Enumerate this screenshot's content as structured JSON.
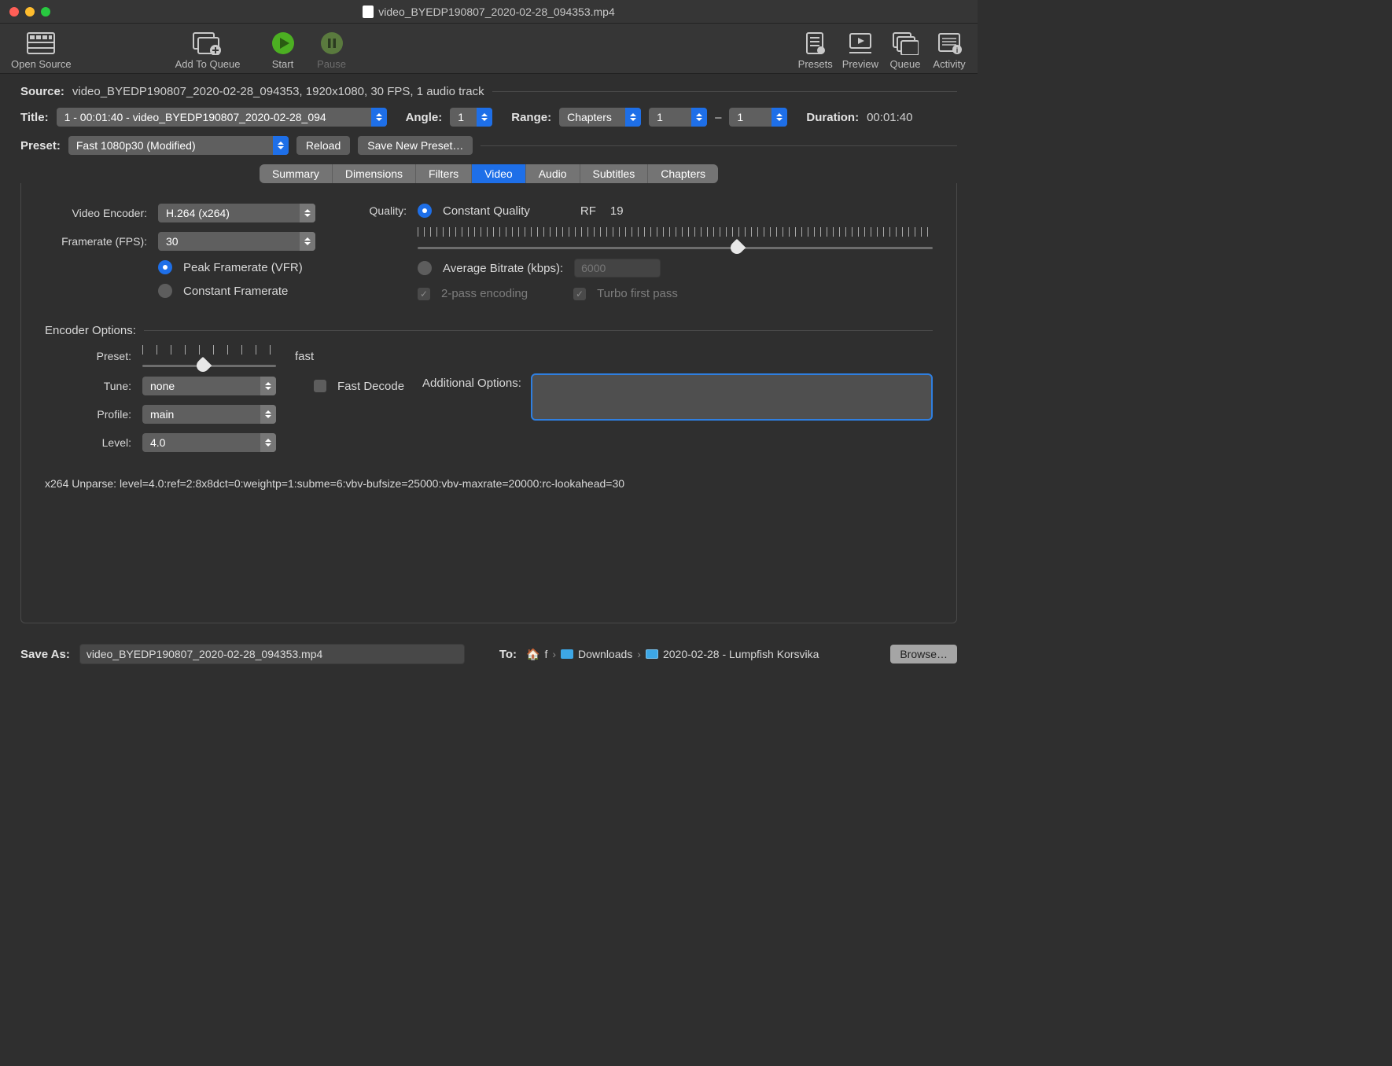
{
  "window": {
    "title": "video_BYEDP190807_2020-02-28_094353.mp4"
  },
  "toolbar": {
    "open_source": "Open Source",
    "add_to_queue": "Add To Queue",
    "start": "Start",
    "pause": "Pause",
    "presets": "Presets",
    "preview": "Preview",
    "queue": "Queue",
    "activity": "Activity"
  },
  "source": {
    "label": "Source:",
    "value": "video_BYEDP190807_2020-02-28_094353, 1920x1080, 30 FPS, 1 audio track"
  },
  "title_row": {
    "label": "Title:",
    "value": "1 - 00:01:40 - video_BYEDP190807_2020-02-28_094",
    "angle_label": "Angle:",
    "angle_value": "1",
    "range_label": "Range:",
    "range_type": "Chapters",
    "range_from": "1",
    "range_sep": "–",
    "range_to": "1",
    "duration_label": "Duration:",
    "duration_value": "00:01:40"
  },
  "preset_row": {
    "label": "Preset:",
    "value": "Fast 1080p30 (Modified)",
    "reload": "Reload",
    "save_new": "Save New Preset…"
  },
  "tabs": [
    "Summary",
    "Dimensions",
    "Filters",
    "Video",
    "Audio",
    "Subtitles",
    "Chapters"
  ],
  "active_tab": "Video",
  "video": {
    "encoder_label": "Video Encoder:",
    "encoder_value": "H.264 (x264)",
    "fps_label": "Framerate (FPS):",
    "fps_value": "30",
    "peak_label": "Peak Framerate (VFR)",
    "constant_label": "Constant Framerate",
    "quality_label": "Quality:",
    "cq_label": "Constant Quality",
    "rf_label": "RF",
    "rf_value": "19",
    "abr_label": "Average Bitrate (kbps):",
    "abr_value": "6000",
    "two_pass": "2-pass encoding",
    "turbo": "Turbo first pass",
    "enc_opts_label": "Encoder Options:",
    "preset_label": "Preset:",
    "preset_value": "fast",
    "tune_label": "Tune:",
    "tune_value": "none",
    "fast_decode": "Fast Decode",
    "profile_label": "Profile:",
    "profile_value": "main",
    "addl_label": "Additional Options:",
    "addl_value": "",
    "level_label": "Level:",
    "level_value": "4.0",
    "unparse": "x264 Unparse: level=4.0:ref=2:8x8dct=0:weightp=1:subme=6:vbv-bufsize=25000:vbv-maxrate=20000:rc-lookahead=30"
  },
  "save": {
    "label": "Save As:",
    "value": "video_BYEDP190807_2020-02-28_094353.mp4",
    "to_label": "To:",
    "crumb_home": "f",
    "crumb_downloads": "Downloads",
    "crumb_folder": "2020-02-28 - Lumpfish Korsvika",
    "browse": "Browse…"
  }
}
